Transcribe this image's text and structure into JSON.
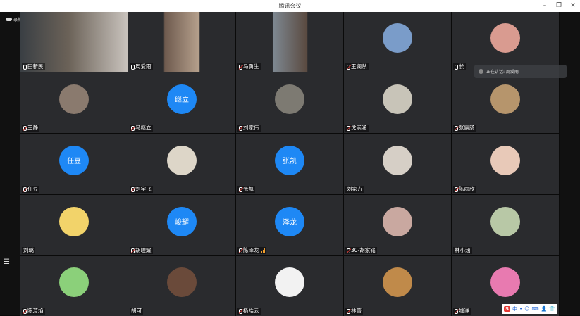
{
  "window": {
    "title": "腾讯会议"
  },
  "recording": {
    "label": "录制中"
  },
  "speaking": {
    "label": "正在讲话: 周爱雨"
  },
  "tray": {
    "logo": "S",
    "items": [
      "中",
      "•",
      "☺",
      "⌨",
      "👤",
      "👕"
    ]
  },
  "participants": [
    {
      "name": "田新民",
      "type": "video",
      "mic": "on"
    },
    {
      "name": "周爱雨",
      "type": "video",
      "mic": "on",
      "active": true
    },
    {
      "name": "马勇生",
      "type": "video",
      "mic": "off"
    },
    {
      "name": "王澜然",
      "type": "photo",
      "mic": "off",
      "color": "#7a9cc9"
    },
    {
      "name": "长",
      "type": "photo",
      "mic": "on",
      "color": "#d99b90"
    },
    {
      "name": "王静",
      "type": "photo",
      "mic": "off",
      "color": "#8a7a6e"
    },
    {
      "name": "马继立",
      "type": "text",
      "mic": "off",
      "avatar_text": "继立"
    },
    {
      "name": "刘家伟",
      "type": "photo",
      "mic": "off",
      "color": "#7d7a72"
    },
    {
      "name": "戈崇涵",
      "type": "photo",
      "mic": "off",
      "color": "#c8c4b8"
    },
    {
      "name": "张震肠",
      "type": "photo",
      "mic": "off",
      "color": "#b6956c"
    },
    {
      "name": "任豆",
      "type": "text",
      "mic": "off",
      "avatar_text": "任豆"
    },
    {
      "name": "刘宇飞",
      "type": "photo",
      "mic": "off",
      "color": "#ddd6c8"
    },
    {
      "name": "张凯",
      "type": "text",
      "mic": "off",
      "avatar_text": "张凯"
    },
    {
      "name": "刘家卉",
      "type": "photo",
      "mic": "none",
      "color": "#d6cfc6"
    },
    {
      "name": "陈雨欣",
      "type": "photo",
      "mic": "off",
      "color": "#e8c9b8"
    },
    {
      "name": "刘璐",
      "type": "photo",
      "mic": "none",
      "color": "#f2d36a"
    },
    {
      "name": "胡峻耀",
      "type": "text",
      "mic": "off",
      "avatar_text": "峻耀"
    },
    {
      "name": "陈泽龙",
      "type": "text",
      "mic": "off",
      "avatar_text": "泽龙",
      "signal": true
    },
    {
      "name": "30-胡家铭",
      "type": "photo",
      "mic": "off",
      "color": "#c9a8a0"
    },
    {
      "name": "林小涵",
      "type": "photo",
      "mic": "none",
      "color": "#b8c8a6"
    },
    {
      "name": "陈芳焰",
      "type": "photo",
      "mic": "off",
      "color": "#8bd07a"
    },
    {
      "name": "胡可",
      "type": "photo",
      "mic": "none",
      "color": "#6a4a3a"
    },
    {
      "name": "杨皓云",
      "type": "photo",
      "mic": "off",
      "color": "#f2f2f2"
    },
    {
      "name": "林蕾",
      "type": "photo",
      "mic": "off",
      "color": "#c08a4a"
    },
    {
      "name": "姚谦",
      "type": "photo",
      "mic": "off",
      "color": "#e87ab0"
    }
  ]
}
